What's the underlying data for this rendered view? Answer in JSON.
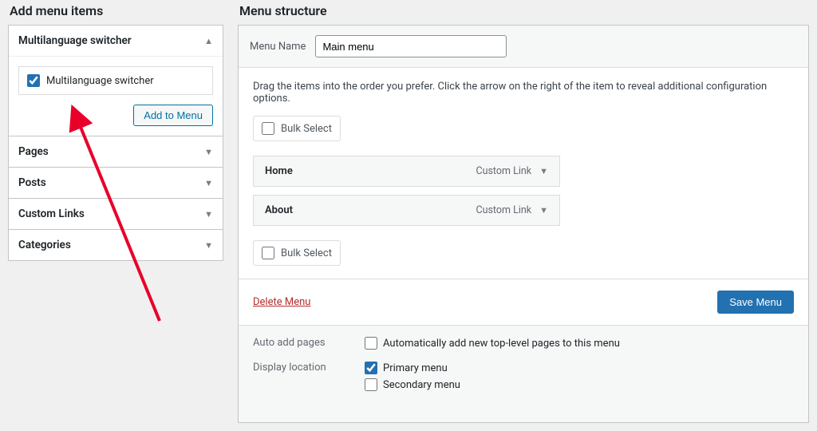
{
  "left": {
    "heading": "Add menu items",
    "switcher": {
      "title": "Multilanguage switcher",
      "item_label": "Multilanguage switcher",
      "button": "Add to Menu"
    },
    "sections": [
      "Pages",
      "Posts",
      "Custom Links",
      "Categories"
    ]
  },
  "right": {
    "heading": "Menu structure",
    "name_label": "Menu Name",
    "name_value": "Main menu",
    "hint": "Drag the items into the order you prefer. Click the arrow on the right of the item to reveal additional configuration options.",
    "bulk_label": "Bulk Select",
    "items": [
      {
        "title": "Home",
        "type": "Custom Link"
      },
      {
        "title": "About",
        "type": "Custom Link"
      }
    ],
    "delete": "Delete Menu",
    "save": "Save Menu",
    "auto_label": "Auto add pages",
    "auto_option": "Automatically add new top-level pages to this menu",
    "loc_label": "Display location",
    "loc_primary": "Primary menu",
    "loc_secondary": "Secondary menu"
  }
}
